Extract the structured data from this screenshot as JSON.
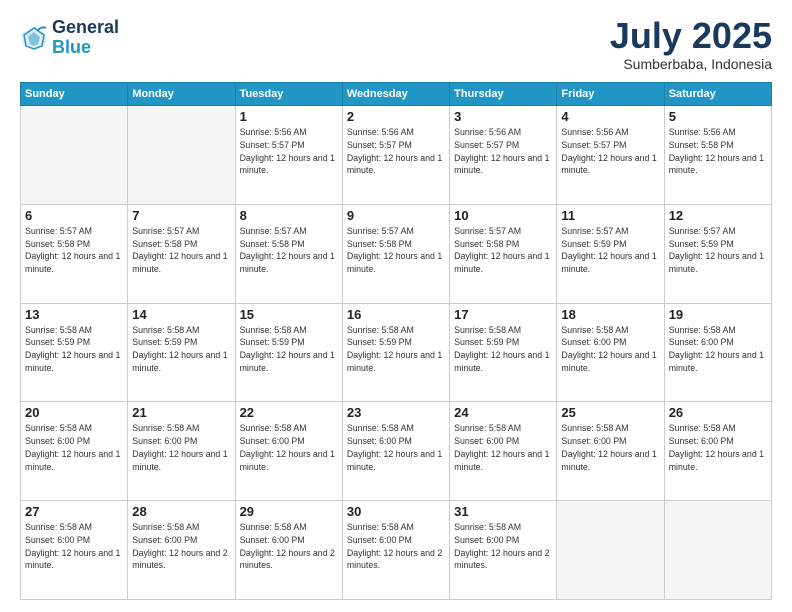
{
  "header": {
    "logo_line1": "General",
    "logo_line2": "Blue",
    "month": "July 2025",
    "location": "Sumberbaba, Indonesia"
  },
  "weekdays": [
    "Sunday",
    "Monday",
    "Tuesday",
    "Wednesday",
    "Thursday",
    "Friday",
    "Saturday"
  ],
  "weeks": [
    [
      {
        "day": "",
        "info": ""
      },
      {
        "day": "",
        "info": ""
      },
      {
        "day": "1",
        "info": "Sunrise: 5:56 AM\nSunset: 5:57 PM\nDaylight: 12 hours\nand 1 minute."
      },
      {
        "day": "2",
        "info": "Sunrise: 5:56 AM\nSunset: 5:57 PM\nDaylight: 12 hours\nand 1 minute."
      },
      {
        "day": "3",
        "info": "Sunrise: 5:56 AM\nSunset: 5:57 PM\nDaylight: 12 hours\nand 1 minute."
      },
      {
        "day": "4",
        "info": "Sunrise: 5:56 AM\nSunset: 5:57 PM\nDaylight: 12 hours\nand 1 minute."
      },
      {
        "day": "5",
        "info": "Sunrise: 5:56 AM\nSunset: 5:58 PM\nDaylight: 12 hours\nand 1 minute."
      }
    ],
    [
      {
        "day": "6",
        "info": "Sunrise: 5:57 AM\nSunset: 5:58 PM\nDaylight: 12 hours\nand 1 minute."
      },
      {
        "day": "7",
        "info": "Sunrise: 5:57 AM\nSunset: 5:58 PM\nDaylight: 12 hours\nand 1 minute."
      },
      {
        "day": "8",
        "info": "Sunrise: 5:57 AM\nSunset: 5:58 PM\nDaylight: 12 hours\nand 1 minute."
      },
      {
        "day": "9",
        "info": "Sunrise: 5:57 AM\nSunset: 5:58 PM\nDaylight: 12 hours\nand 1 minute."
      },
      {
        "day": "10",
        "info": "Sunrise: 5:57 AM\nSunset: 5:58 PM\nDaylight: 12 hours\nand 1 minute."
      },
      {
        "day": "11",
        "info": "Sunrise: 5:57 AM\nSunset: 5:59 PM\nDaylight: 12 hours\nand 1 minute."
      },
      {
        "day": "12",
        "info": "Sunrise: 5:57 AM\nSunset: 5:59 PM\nDaylight: 12 hours\nand 1 minute."
      }
    ],
    [
      {
        "day": "13",
        "info": "Sunrise: 5:58 AM\nSunset: 5:59 PM\nDaylight: 12 hours\nand 1 minute."
      },
      {
        "day": "14",
        "info": "Sunrise: 5:58 AM\nSunset: 5:59 PM\nDaylight: 12 hours\nand 1 minute."
      },
      {
        "day": "15",
        "info": "Sunrise: 5:58 AM\nSunset: 5:59 PM\nDaylight: 12 hours\nand 1 minute."
      },
      {
        "day": "16",
        "info": "Sunrise: 5:58 AM\nSunset: 5:59 PM\nDaylight: 12 hours\nand 1 minute."
      },
      {
        "day": "17",
        "info": "Sunrise: 5:58 AM\nSunset: 5:59 PM\nDaylight: 12 hours\nand 1 minute."
      },
      {
        "day": "18",
        "info": "Sunrise: 5:58 AM\nSunset: 6:00 PM\nDaylight: 12 hours\nand 1 minute."
      },
      {
        "day": "19",
        "info": "Sunrise: 5:58 AM\nSunset: 6:00 PM\nDaylight: 12 hours\nand 1 minute."
      }
    ],
    [
      {
        "day": "20",
        "info": "Sunrise: 5:58 AM\nSunset: 6:00 PM\nDaylight: 12 hours\nand 1 minute."
      },
      {
        "day": "21",
        "info": "Sunrise: 5:58 AM\nSunset: 6:00 PM\nDaylight: 12 hours\nand 1 minute."
      },
      {
        "day": "22",
        "info": "Sunrise: 5:58 AM\nSunset: 6:00 PM\nDaylight: 12 hours\nand 1 minute."
      },
      {
        "day": "23",
        "info": "Sunrise: 5:58 AM\nSunset: 6:00 PM\nDaylight: 12 hours\nand 1 minute."
      },
      {
        "day": "24",
        "info": "Sunrise: 5:58 AM\nSunset: 6:00 PM\nDaylight: 12 hours\nand 1 minute."
      },
      {
        "day": "25",
        "info": "Sunrise: 5:58 AM\nSunset: 6:00 PM\nDaylight: 12 hours\nand 1 minute."
      },
      {
        "day": "26",
        "info": "Sunrise: 5:58 AM\nSunset: 6:00 PM\nDaylight: 12 hours\nand 1 minute."
      }
    ],
    [
      {
        "day": "27",
        "info": "Sunrise: 5:58 AM\nSunset: 6:00 PM\nDaylight: 12 hours\nand 1 minute."
      },
      {
        "day": "28",
        "info": "Sunrise: 5:58 AM\nSunset: 6:00 PM\nDaylight: 12 hours\nand 2 minutes."
      },
      {
        "day": "29",
        "info": "Sunrise: 5:58 AM\nSunset: 6:00 PM\nDaylight: 12 hours\nand 2 minutes."
      },
      {
        "day": "30",
        "info": "Sunrise: 5:58 AM\nSunset: 6:00 PM\nDaylight: 12 hours\nand 2 minutes."
      },
      {
        "day": "31",
        "info": "Sunrise: 5:58 AM\nSunset: 6:00 PM\nDaylight: 12 hours\nand 2 minutes."
      },
      {
        "day": "",
        "info": ""
      },
      {
        "day": "",
        "info": ""
      }
    ]
  ]
}
